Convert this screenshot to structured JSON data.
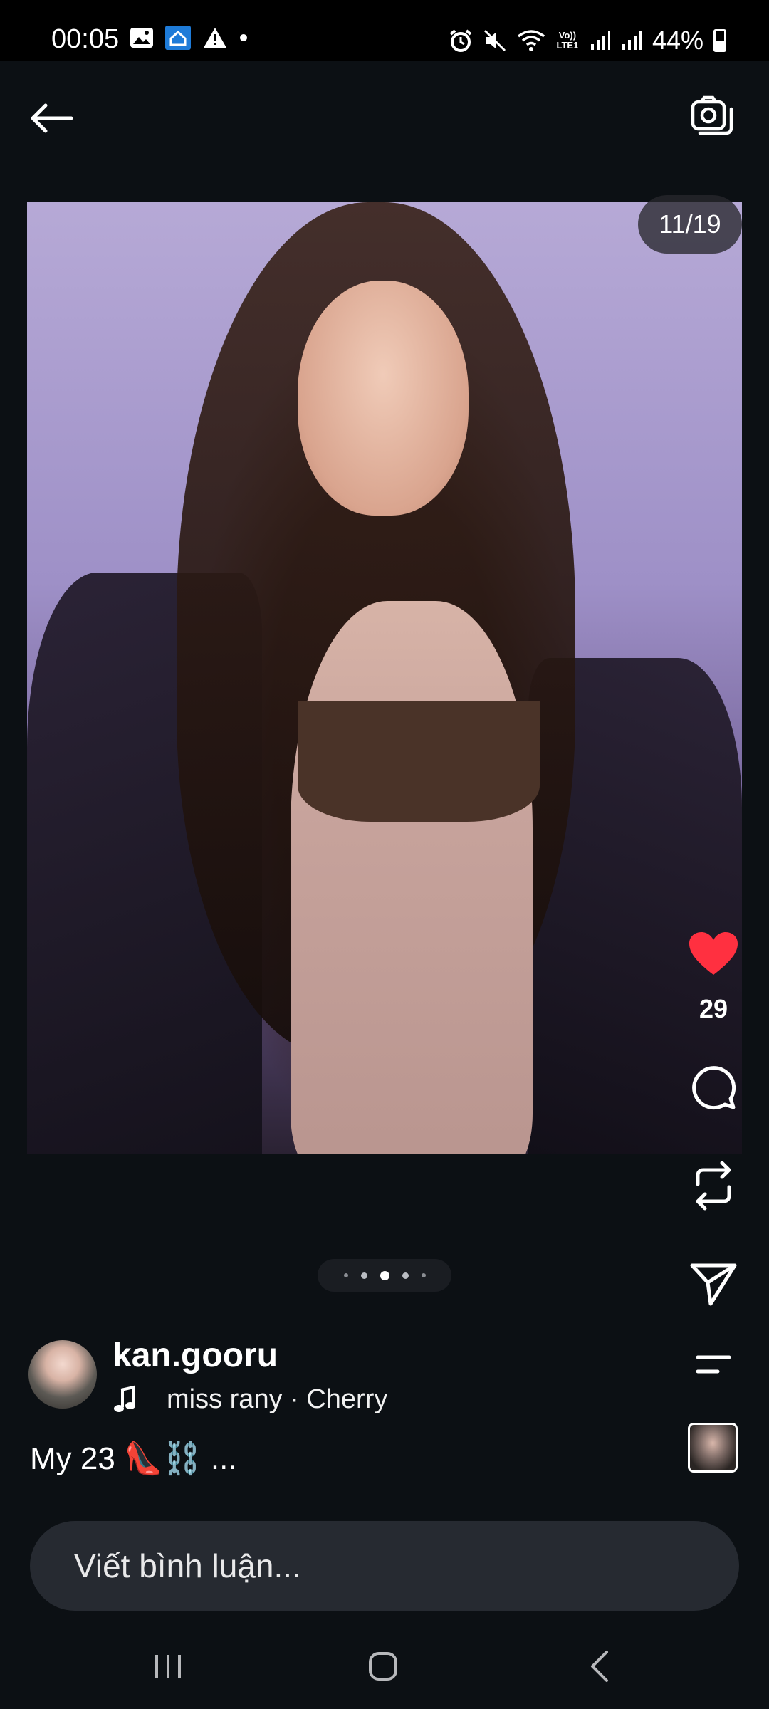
{
  "status_bar": {
    "time": "00:05",
    "battery": "44%",
    "network_badge": "Vo)) LTE1",
    "left_icons": [
      "gallery-icon",
      "smart-home-icon",
      "warning-icon",
      "dot-icon"
    ],
    "right_icons": [
      "alarm-icon",
      "mute-icon",
      "wifi-icon",
      "signal-icon",
      "signal-icon",
      "battery-icon"
    ]
  },
  "top_bar": {
    "back_icon": "arrow-left-icon",
    "camera_icon": "camera-icon"
  },
  "post": {
    "image_counter": "11/19",
    "like_count": "29",
    "author": "kan.gooru",
    "music": "miss rany · Cherry",
    "caption": "My 23 👠⛓️ ...",
    "pagination": {
      "dots": 5,
      "active_index": 2
    }
  },
  "actions": [
    "heart-icon",
    "comment-icon",
    "repost-icon",
    "share-icon",
    "menu-icon"
  ],
  "comment_box": {
    "placeholder": "Viết bình luận..."
  },
  "colors": {
    "background": "#0c1014",
    "like_red": "#ff3040",
    "input_bg": "#262a31"
  }
}
